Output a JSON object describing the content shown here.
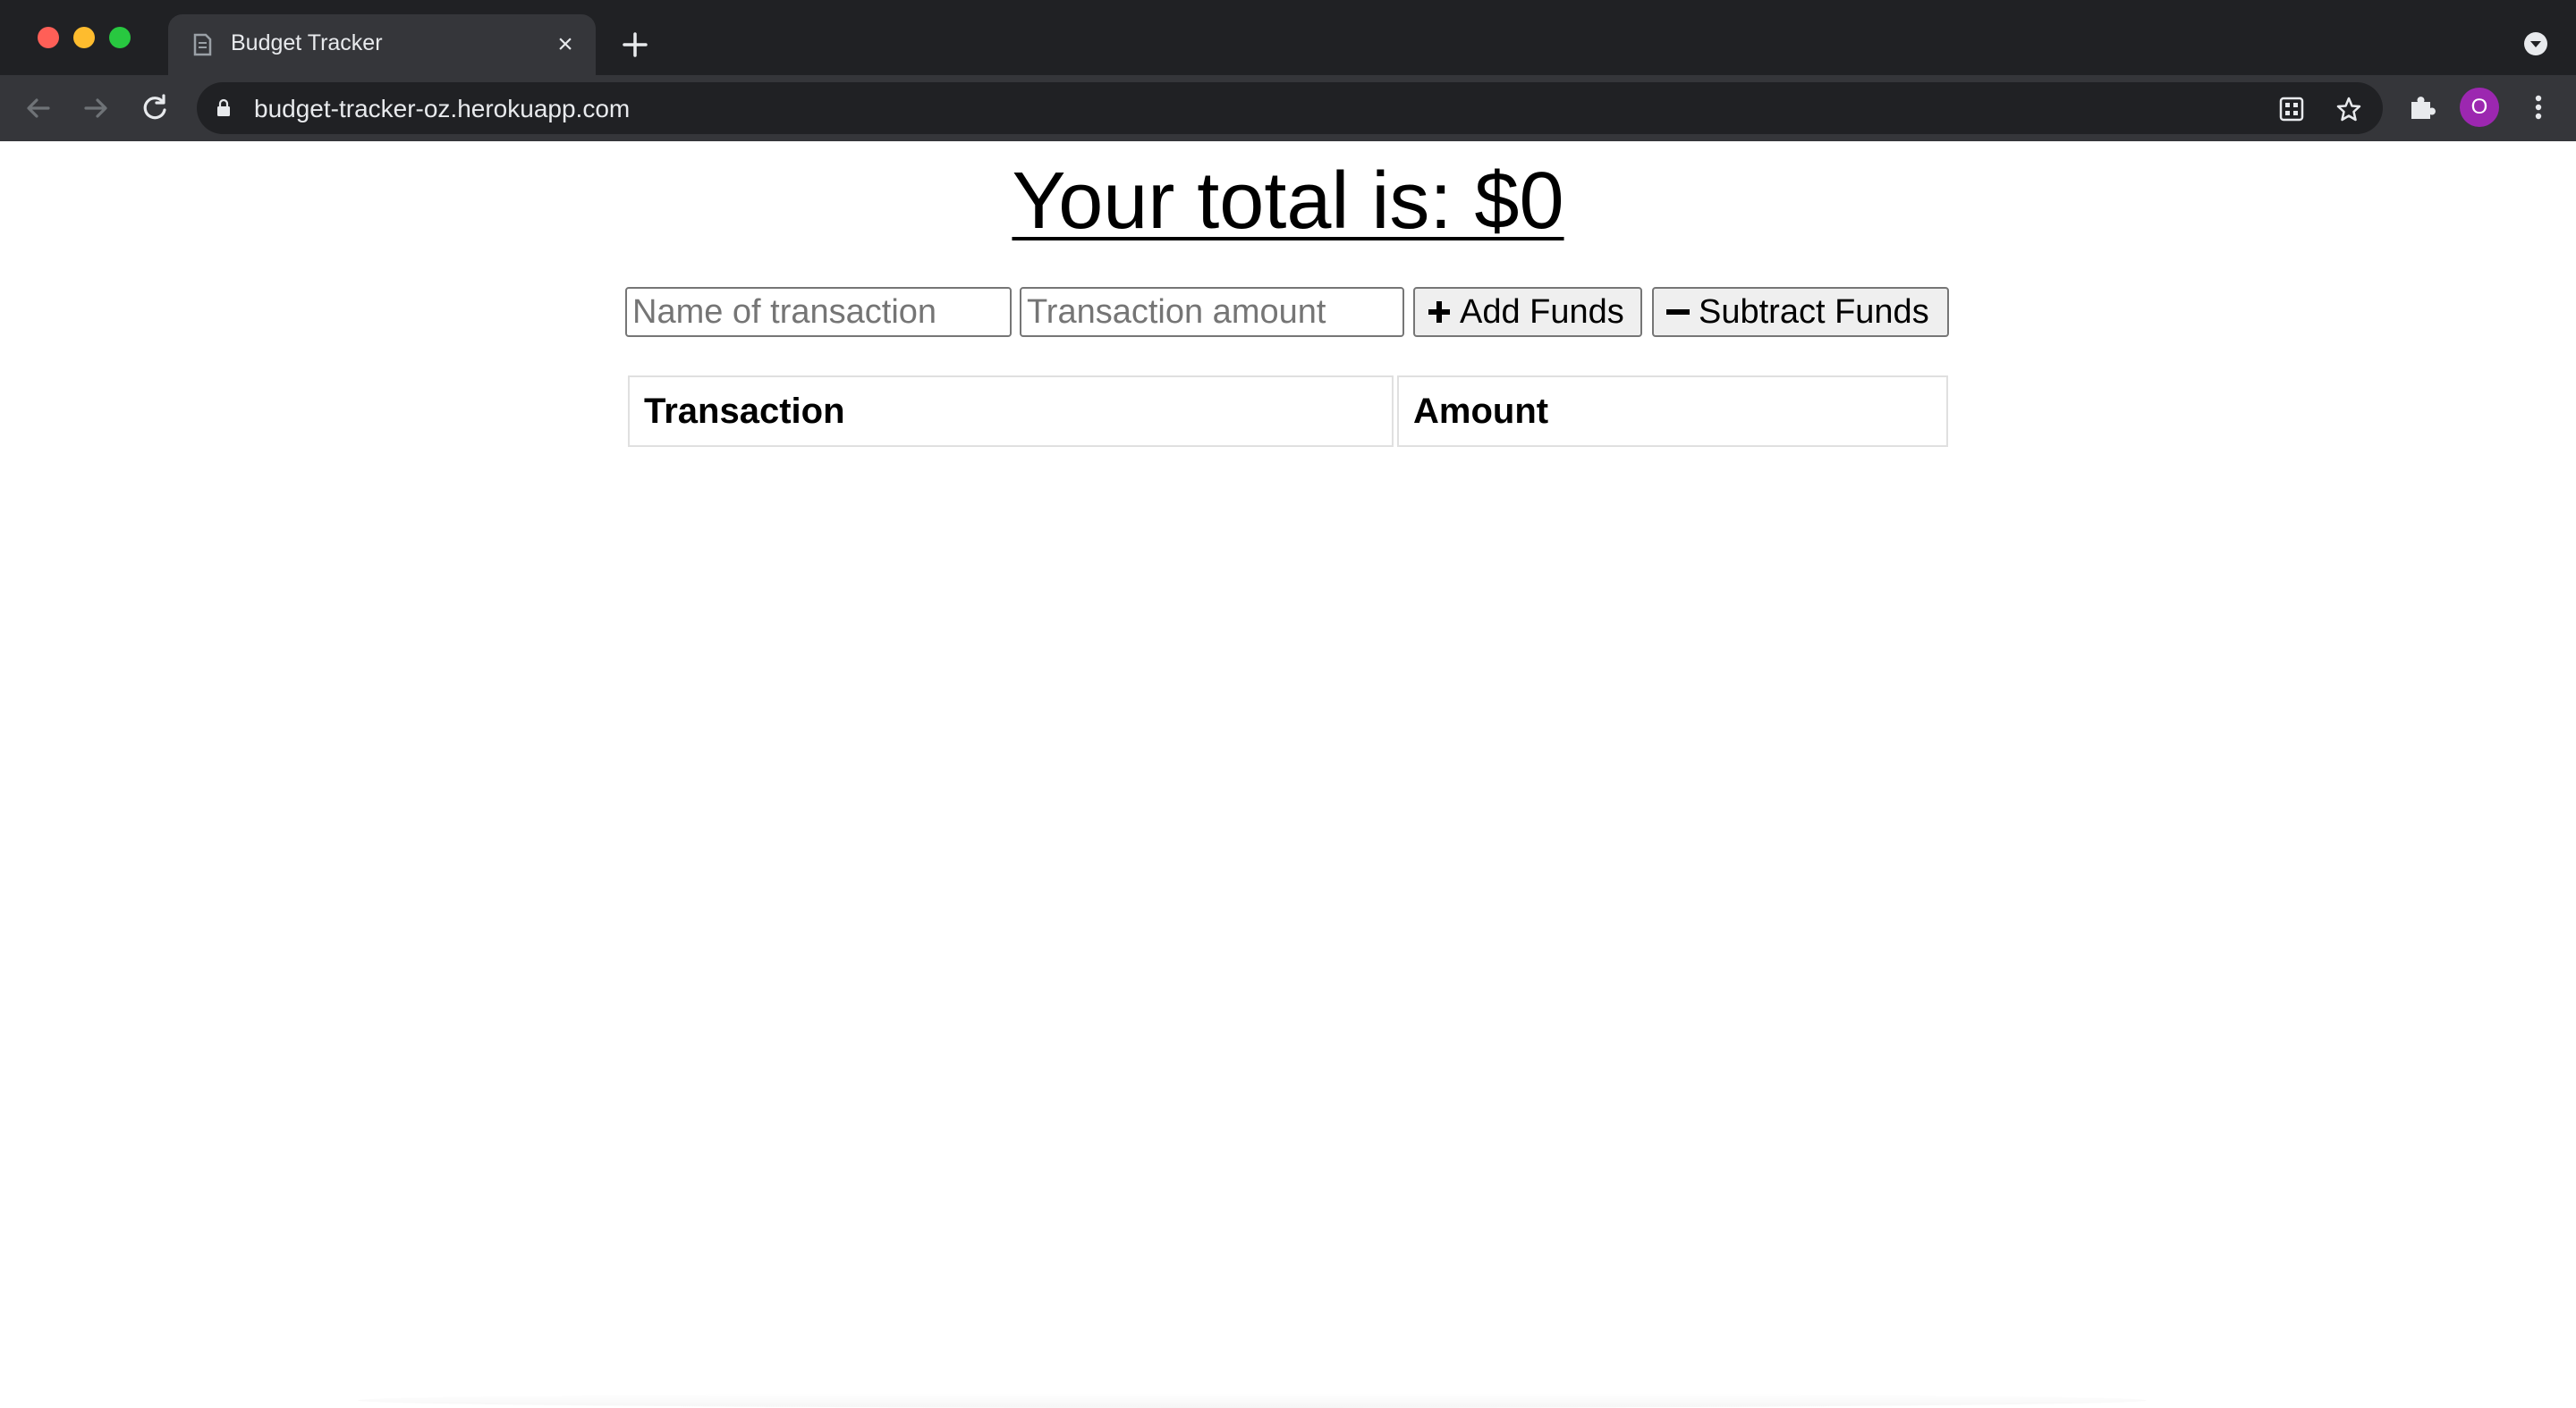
{
  "browser": {
    "tab": {
      "title": "Budget Tracker",
      "close_glyph": "×"
    },
    "address_bar": {
      "url": "budget-tracker-oz.herokuapp.com"
    },
    "profile_initial": "O",
    "icons": {
      "favicon": "document-icon",
      "back": "arrow-left-icon",
      "forward": "arrow-right-icon",
      "reload": "reload-icon",
      "lock": "lock-icon",
      "qr": "qr-code-icon",
      "bookmark": "star-icon",
      "extensions": "puzzle-icon",
      "menu": "kebab-menu-icon",
      "new_tab": "plus-icon",
      "tab_search": "chevron-down-icon"
    },
    "colors": {
      "chrome_dark": "#202124",
      "chrome_toolbar": "#35363a",
      "avatar": "#9c27b0"
    }
  },
  "page": {
    "total_text": "Your total is: $0",
    "form": {
      "name_placeholder": "Name of transaction",
      "amount_placeholder": "Transaction amount",
      "add_label": "Add Funds",
      "subtract_label": "Subtract Funds",
      "add_icon": "plus-icon",
      "subtract_icon": "minus-icon"
    },
    "table": {
      "headers": [
        "Transaction",
        "Amount"
      ],
      "rows": []
    }
  }
}
